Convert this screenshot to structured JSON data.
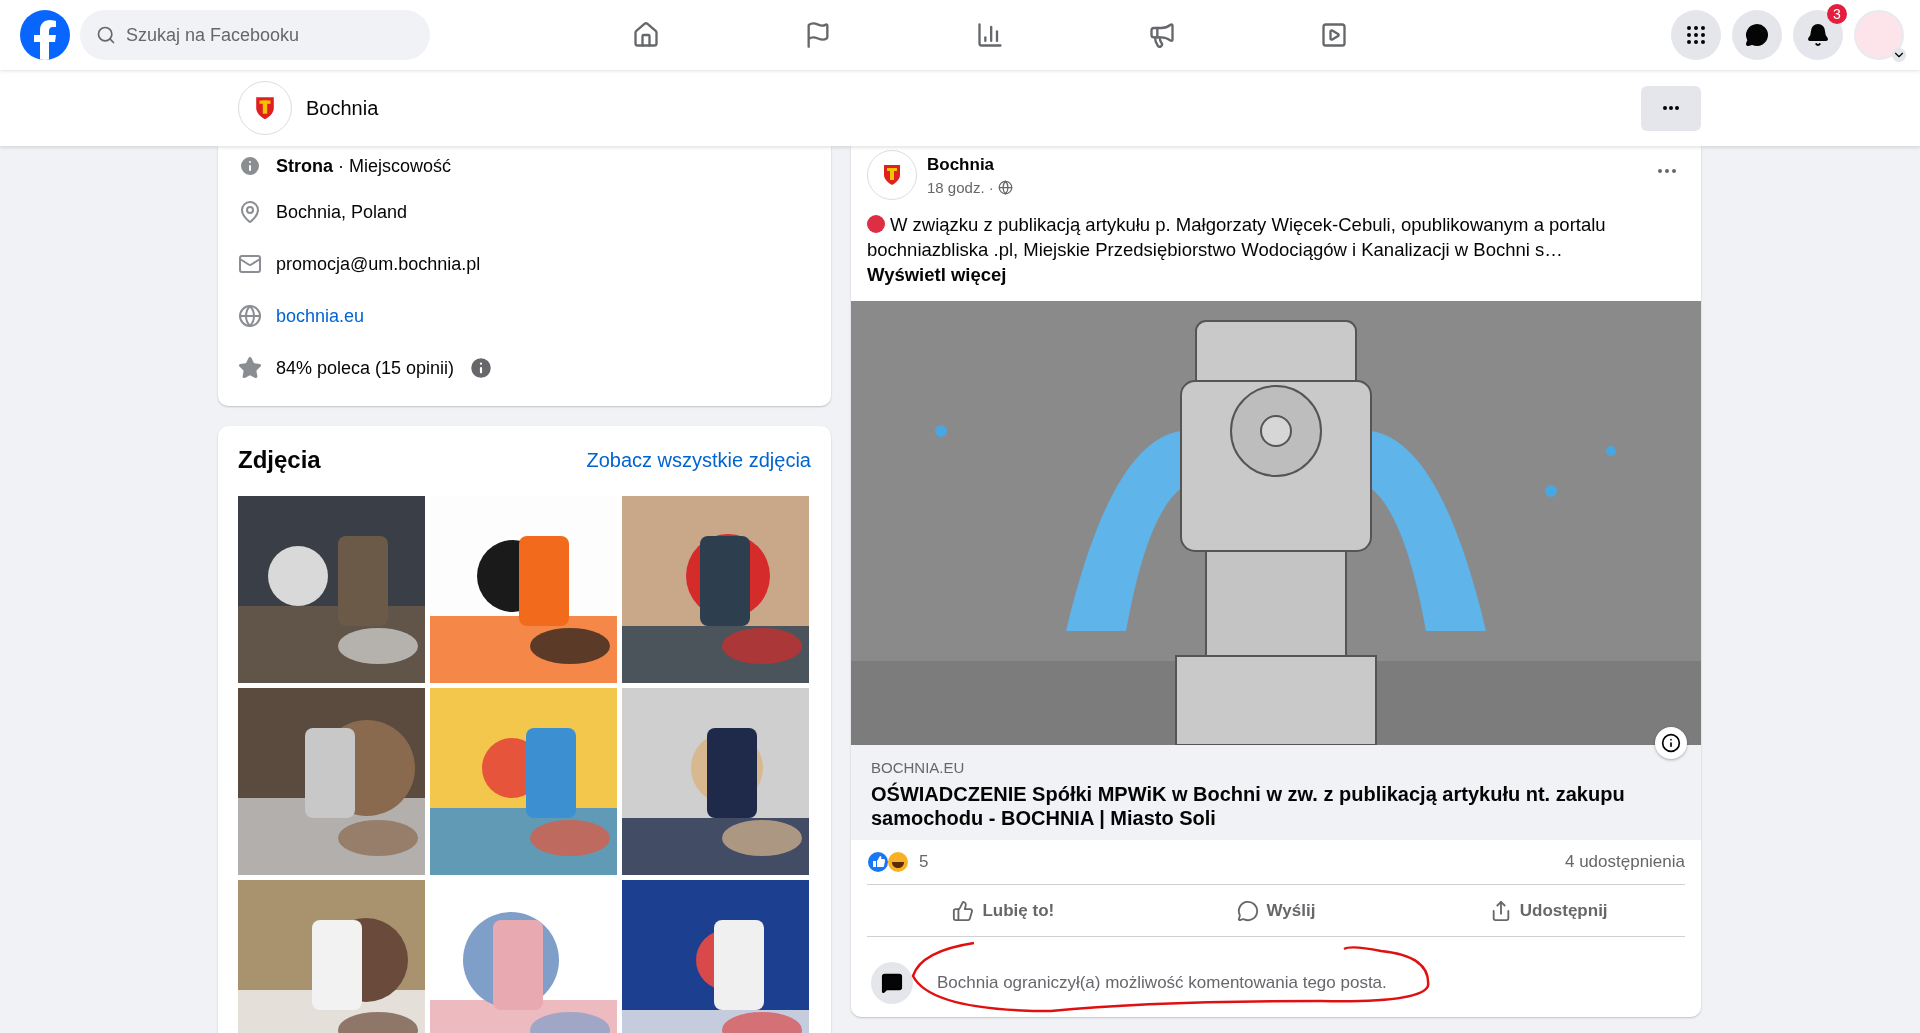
{
  "topbar": {
    "search_placeholder": "Szukaj na Facebooku",
    "notifications_badge": "3"
  },
  "page_header": {
    "name": "Bochnia"
  },
  "intro": {
    "items": [
      {
        "kind": "category",
        "text": "**Strona** · Miejscowość"
      },
      {
        "kind": "address",
        "text": "Bochnia, Poland"
      },
      {
        "kind": "email",
        "text": "promocja@um.bochnia.pl"
      },
      {
        "kind": "website",
        "text": "bochnia.eu"
      },
      {
        "kind": "rating",
        "text": "84% poleca (15 opinii)"
      }
    ]
  },
  "photos": {
    "title": "Zdjęcia",
    "see_all": "Zobacz wszystkie zdjęcia"
  },
  "post": {
    "author": "Bochnia",
    "time": "18 godz. ·",
    "text": "W związku z publikacją artykułu p. Małgorzaty Więcek-Cebuli, opublikowanym a portalu bochniazbliska .pl, Miejskie Przedsiębiorstwo Wodociągów i Kanalizacji w Bochni s…",
    "see_more": "Wyświetl więcej",
    "link": {
      "domain": "BOCHNIA.EU",
      "title": "OŚWIADCZENIE Spółki MPWiK w Bochni w zw. z publikacją artykułu nt. zakupu samochodu - BOCHNIA | Miasto Soli"
    },
    "reactions_count": "5",
    "shares": "4 udostępnienia",
    "actions": [
      {
        "kind": "like",
        "label": "Lubię to!"
      },
      {
        "kind": "send",
        "label": "Wyślij"
      },
      {
        "kind": "share",
        "label": "Udostępnij"
      }
    ],
    "comment_notice": "Bochnia ograniczył(a) możliwość komentowania tego posta."
  }
}
